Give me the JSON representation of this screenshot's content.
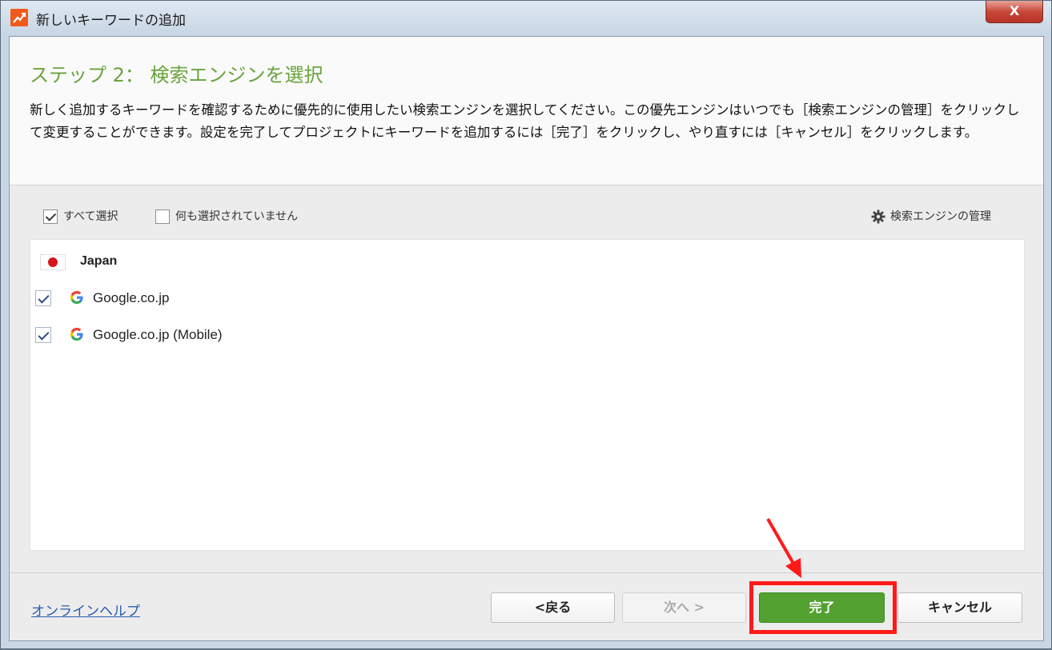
{
  "window": {
    "title": "新しいキーワードの追加",
    "close_label": "X"
  },
  "header": {
    "step_title": "ステップ 2： 検索エンジンを選択",
    "description": "新しく追加するキーワードを確認するために優先的に使用したい検索エンジンを選択してください。この優先エンジンはいつでも［検索エンジンの管理］をクリックして変更することができます。設定を完了してプロジェクトにキーワードを追加するには［完了］をクリックし、やり直すには［キャンセル］をクリックします。"
  },
  "toolbar": {
    "select_all_label": "すべて選択",
    "select_all_checked": true,
    "select_none_label": "何も選択されていません",
    "select_none_checked": false,
    "manage_label": "検索エンジンの管理",
    "manage_icon": "gear-icon"
  },
  "engines": {
    "group_name": "Japan",
    "group_flag": "japan-flag-icon",
    "items": [
      {
        "name": "Google.co.jp",
        "checked": true,
        "icon": "google-icon"
      },
      {
        "name": "Google.co.jp (Mobile)",
        "checked": true,
        "icon": "google-icon"
      }
    ]
  },
  "footer": {
    "help_link": "オンラインヘルプ",
    "back_label": "<戻る",
    "next_label": "次へ >",
    "finish_label": "完了",
    "cancel_label": "キャンセル"
  },
  "colors": {
    "accent_green": "#6aa43c",
    "finish_button": "#53a131",
    "highlight": "#ff1a1a",
    "link": "#2a5db0"
  }
}
